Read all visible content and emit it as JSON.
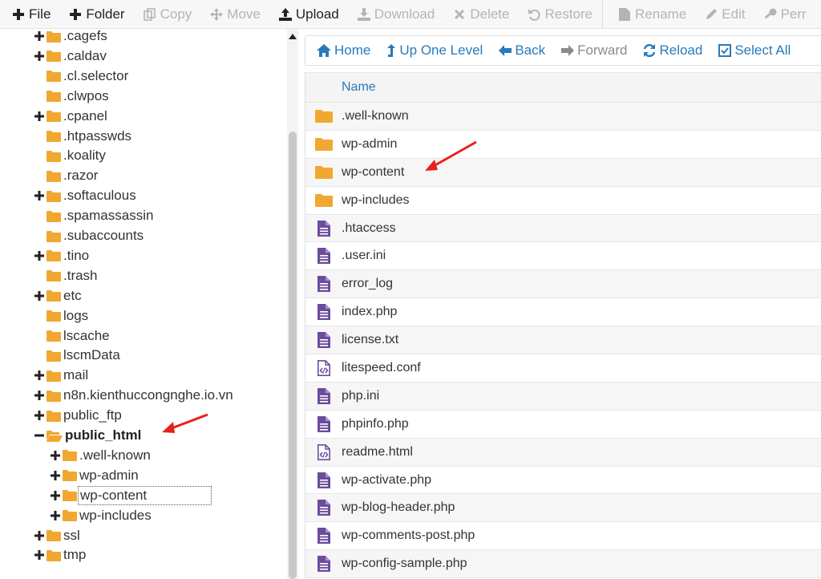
{
  "toolbar": {
    "file": "File",
    "folder": "Folder",
    "copy": "Copy",
    "move": "Move",
    "upload": "Upload",
    "download": "Download",
    "delete": "Delete",
    "restore": "Restore",
    "rename": "Rename",
    "edit": "Edit",
    "perms": "Perr"
  },
  "tree": {
    "items": [
      {
        "label": ".cagefs",
        "expandable": true
      },
      {
        "label": ".caldav",
        "expandable": true
      },
      {
        "label": ".cl.selector",
        "expandable": false
      },
      {
        "label": ".clwpos",
        "expandable": false
      },
      {
        "label": ".cpanel",
        "expandable": true
      },
      {
        "label": ".htpasswds",
        "expandable": false
      },
      {
        "label": ".koality",
        "expandable": false
      },
      {
        "label": ".razor",
        "expandable": false
      },
      {
        "label": ".softaculous",
        "expandable": true
      },
      {
        "label": ".spamassassin",
        "expandable": false
      },
      {
        "label": ".subaccounts",
        "expandable": false
      },
      {
        "label": ".tino",
        "expandable": true
      },
      {
        "label": ".trash",
        "expandable": false
      },
      {
        "label": "etc",
        "expandable": true
      },
      {
        "label": "logs",
        "expandable": false
      },
      {
        "label": "lscache",
        "expandable": false
      },
      {
        "label": "lscmData",
        "expandable": false
      },
      {
        "label": "mail",
        "expandable": true
      },
      {
        "label": "n8n.kienthuccongnghe.io.vn",
        "expandable": true
      },
      {
        "label": "public_ftp",
        "expandable": true
      },
      {
        "label": "public_html",
        "expandable": true,
        "expanded": true
      },
      {
        "label": ".well-known",
        "expandable": true,
        "child": true
      },
      {
        "label": "wp-admin",
        "expandable": true,
        "child": true
      },
      {
        "label": "wp-content",
        "expandable": true,
        "child": true,
        "selected": true
      },
      {
        "label": "wp-includes",
        "expandable": true,
        "child": true
      },
      {
        "label": "ssl",
        "expandable": true
      },
      {
        "label": "tmp",
        "expandable": true
      }
    ]
  },
  "nav": {
    "home": "Home",
    "up": "Up One Level",
    "back": "Back",
    "forward": "Forward",
    "reload": "Reload",
    "select_all": "Select All"
  },
  "files": {
    "header_name": "Name",
    "rows": [
      {
        "name": ".well-known",
        "type": "folder"
      },
      {
        "name": "wp-admin",
        "type": "folder"
      },
      {
        "name": "wp-content",
        "type": "folder"
      },
      {
        "name": "wp-includes",
        "type": "folder"
      },
      {
        "name": ".htaccess",
        "type": "text"
      },
      {
        "name": ".user.ini",
        "type": "text"
      },
      {
        "name": "error_log",
        "type": "text"
      },
      {
        "name": "index.php",
        "type": "text"
      },
      {
        "name": "license.txt",
        "type": "text"
      },
      {
        "name": "litespeed.conf",
        "type": "code"
      },
      {
        "name": "php.ini",
        "type": "text"
      },
      {
        "name": "phpinfo.php",
        "type": "text"
      },
      {
        "name": "readme.html",
        "type": "code"
      },
      {
        "name": "wp-activate.php",
        "type": "text"
      },
      {
        "name": "wp-blog-header.php",
        "type": "text"
      },
      {
        "name": "wp-comments-post.php",
        "type": "text"
      },
      {
        "name": "wp-config-sample.php",
        "type": "text"
      }
    ]
  },
  "colors": {
    "folder": "#f0a830",
    "file": "#6c4c9c",
    "link": "#2a7ab8",
    "annotation": "#e8211c"
  }
}
